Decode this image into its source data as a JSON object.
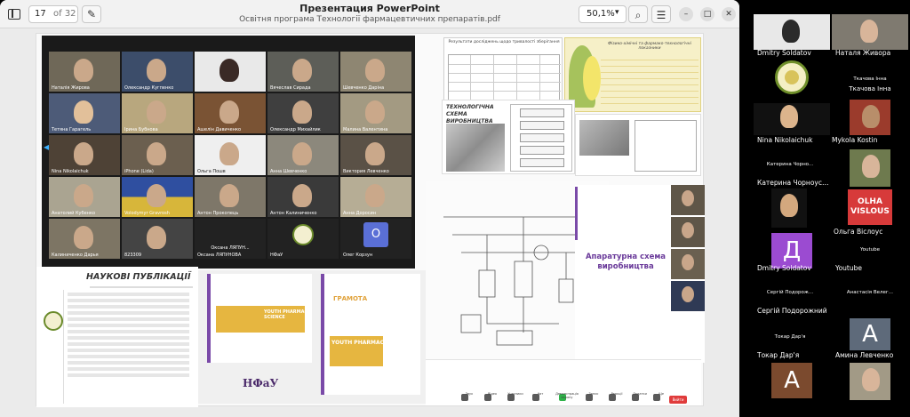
{
  "viewer": {
    "page_current": "17",
    "page_of": "of 32",
    "title": "Презентация PowerPoint",
    "subtitle": "Освітня програма Технології фармацевтичних препаратів.pdf",
    "zoom": "50,1%"
  },
  "gallery": {
    "rows": [
      [
        "Наталія Жирова",
        "Олександр Кугпенко",
        "",
        "Вячеслав Сирада",
        "Шевченко Даріна"
      ],
      [
        "Тетяна Гарагель",
        "Ірина Бубнова",
        "Ашелін Давиченко",
        "Олександр Михайлик",
        "Малина Валентина"
      ],
      [
        "Nina Nikolaichuk",
        "iPhone (Lida)",
        "Ольга Пошв",
        "Анна Шевченко",
        "Виктория Левченко"
      ],
      [
        "Анатолий Кубенко",
        "Volodymyr Gravrosh",
        "Антон Прокопець",
        "Антон Калиниченко",
        "Анна Доросин"
      ],
      [
        "Калиниченко Дарья",
        "823309",
        "Оксана ЛЯПУН...",
        "НФаУ",
        "Олег Корзун"
      ]
    ],
    "dark_tile_names": [
      "Оксана ЛЯПУН...",
      "Оксана ЛЯПУНОВА"
    ],
    "avatar_letter": "О",
    "avatar_color": "#5a6fd6"
  },
  "slide": {
    "research_title": "Результати досліджень щодо тривалості зберігання",
    "yellow_title": "Фізико-хімічні та фармако-технологічні показники",
    "tech_scheme_title": "ТЕХНОЛОГІЧНА СХЕМА ВИРОБНИЦТВА",
    "publications_title": "НАУКОВІ ПУБЛІКАЦІЇ",
    "cert_youth": "YOUTH PHARMACY SCIENCE",
    "cert_gramota": "ГРАМОТА",
    "nfau": "НФаУ",
    "apparatus_title": "Апаратурна схема виробництва"
  },
  "zoom_controls": {
    "items": [
      "Звук",
      "Відео",
      "Учасники",
      "Чат",
      "Демонстрація екрану",
      "Запис",
      "Реакції",
      "Додатки",
      "Ще"
    ],
    "end_label": "Вийти",
    "end_color": "#e03c3c"
  },
  "participants": [
    {
      "name": "Dmitry Soldatov",
      "type": "video"
    },
    {
      "name": "Наталя Живора",
      "type": "video"
    },
    {
      "name": "",
      "type": "logo"
    },
    {
      "name": "Ткачова Інна",
      "type": "label"
    },
    {
      "name": "Nina Nikolaichuk",
      "type": "video"
    },
    {
      "name": "Mykola Kostin",
      "type": "video"
    },
    {
      "name": "Катерина Чорнo...",
      "type": "label"
    },
    {
      "name": "Катерина Чорноусенко",
      "type": "label2"
    },
    {
      "name": "Ольга Віслоус",
      "type": "olha"
    },
    {
      "name": "Dmitry Soldatov",
      "type": "avatar",
      "letter": "Д",
      "color": "#9b4bd1"
    },
    {
      "name": "Youtube",
      "type": "label"
    },
    {
      "name": "Сергій Подорожний",
      "type": "label"
    },
    {
      "name": "Анастасія Велег...",
      "type": "label"
    },
    {
      "name": "Амина Левченко",
      "type": "avatar",
      "letter": "А",
      "color": "#5e6a7a"
    },
    {
      "name": "Токар Дар'я",
      "type": "label"
    },
    {
      "name": "",
      "type": "avatar",
      "letter": "А",
      "color": "#7b4a2e"
    }
  ],
  "right_panel": {
    "tile_labels": {
      "olha_text": "OLHA VISLOUS",
      "youtube_small": "Youtube",
      "serhii_small": "Сергій Подорож...",
      "anastasiia_small": "Анастасія Велег...",
      "tokar_small": "Токар Дар'я"
    }
  }
}
